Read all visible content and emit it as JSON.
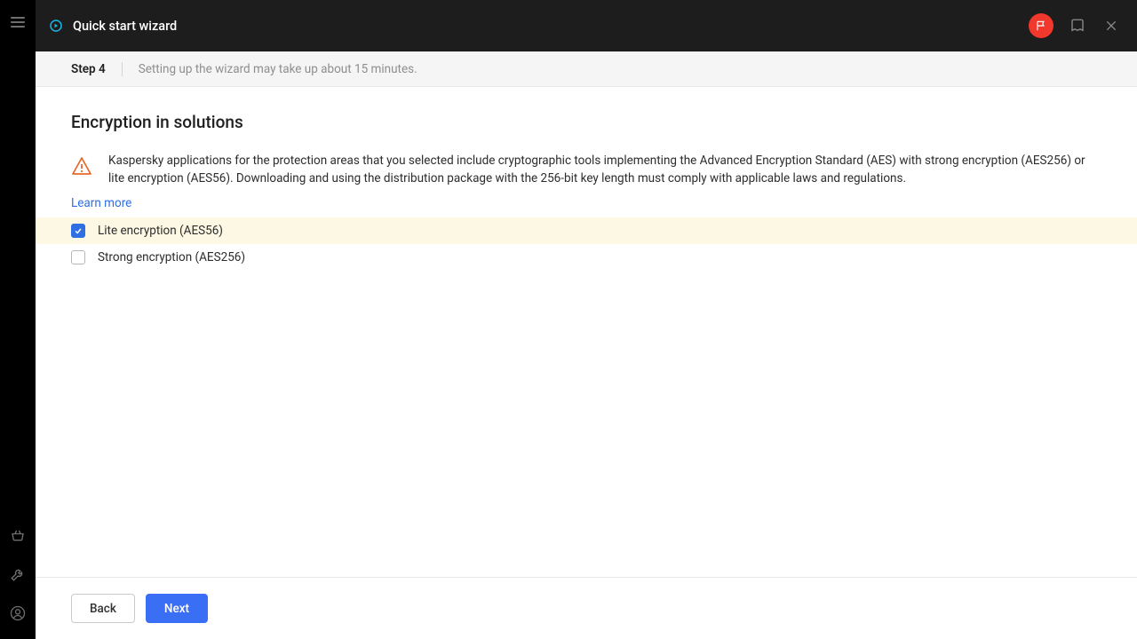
{
  "header": {
    "title": "Quick start wizard"
  },
  "step": {
    "label": "Step 4",
    "note": "Setting up the wizard may take up about 15 minutes."
  },
  "section": {
    "title": "Encryption in solutions",
    "description": "Kaspersky applications for the protection areas that you selected include cryptographic tools implementing the Advanced Encryption Standard (AES) with strong encryption (AES256) or lite encryption (AES56). Downloading and using the distribution package with the 256-bit key length must comply with applicable laws and regulations.",
    "learn_more": "Learn more",
    "options": [
      {
        "label": "Lite encryption (AES56)",
        "checked": true
      },
      {
        "label": "Strong encryption (AES256)",
        "checked": false
      }
    ]
  },
  "footer": {
    "back": "Back",
    "next": "Next"
  }
}
